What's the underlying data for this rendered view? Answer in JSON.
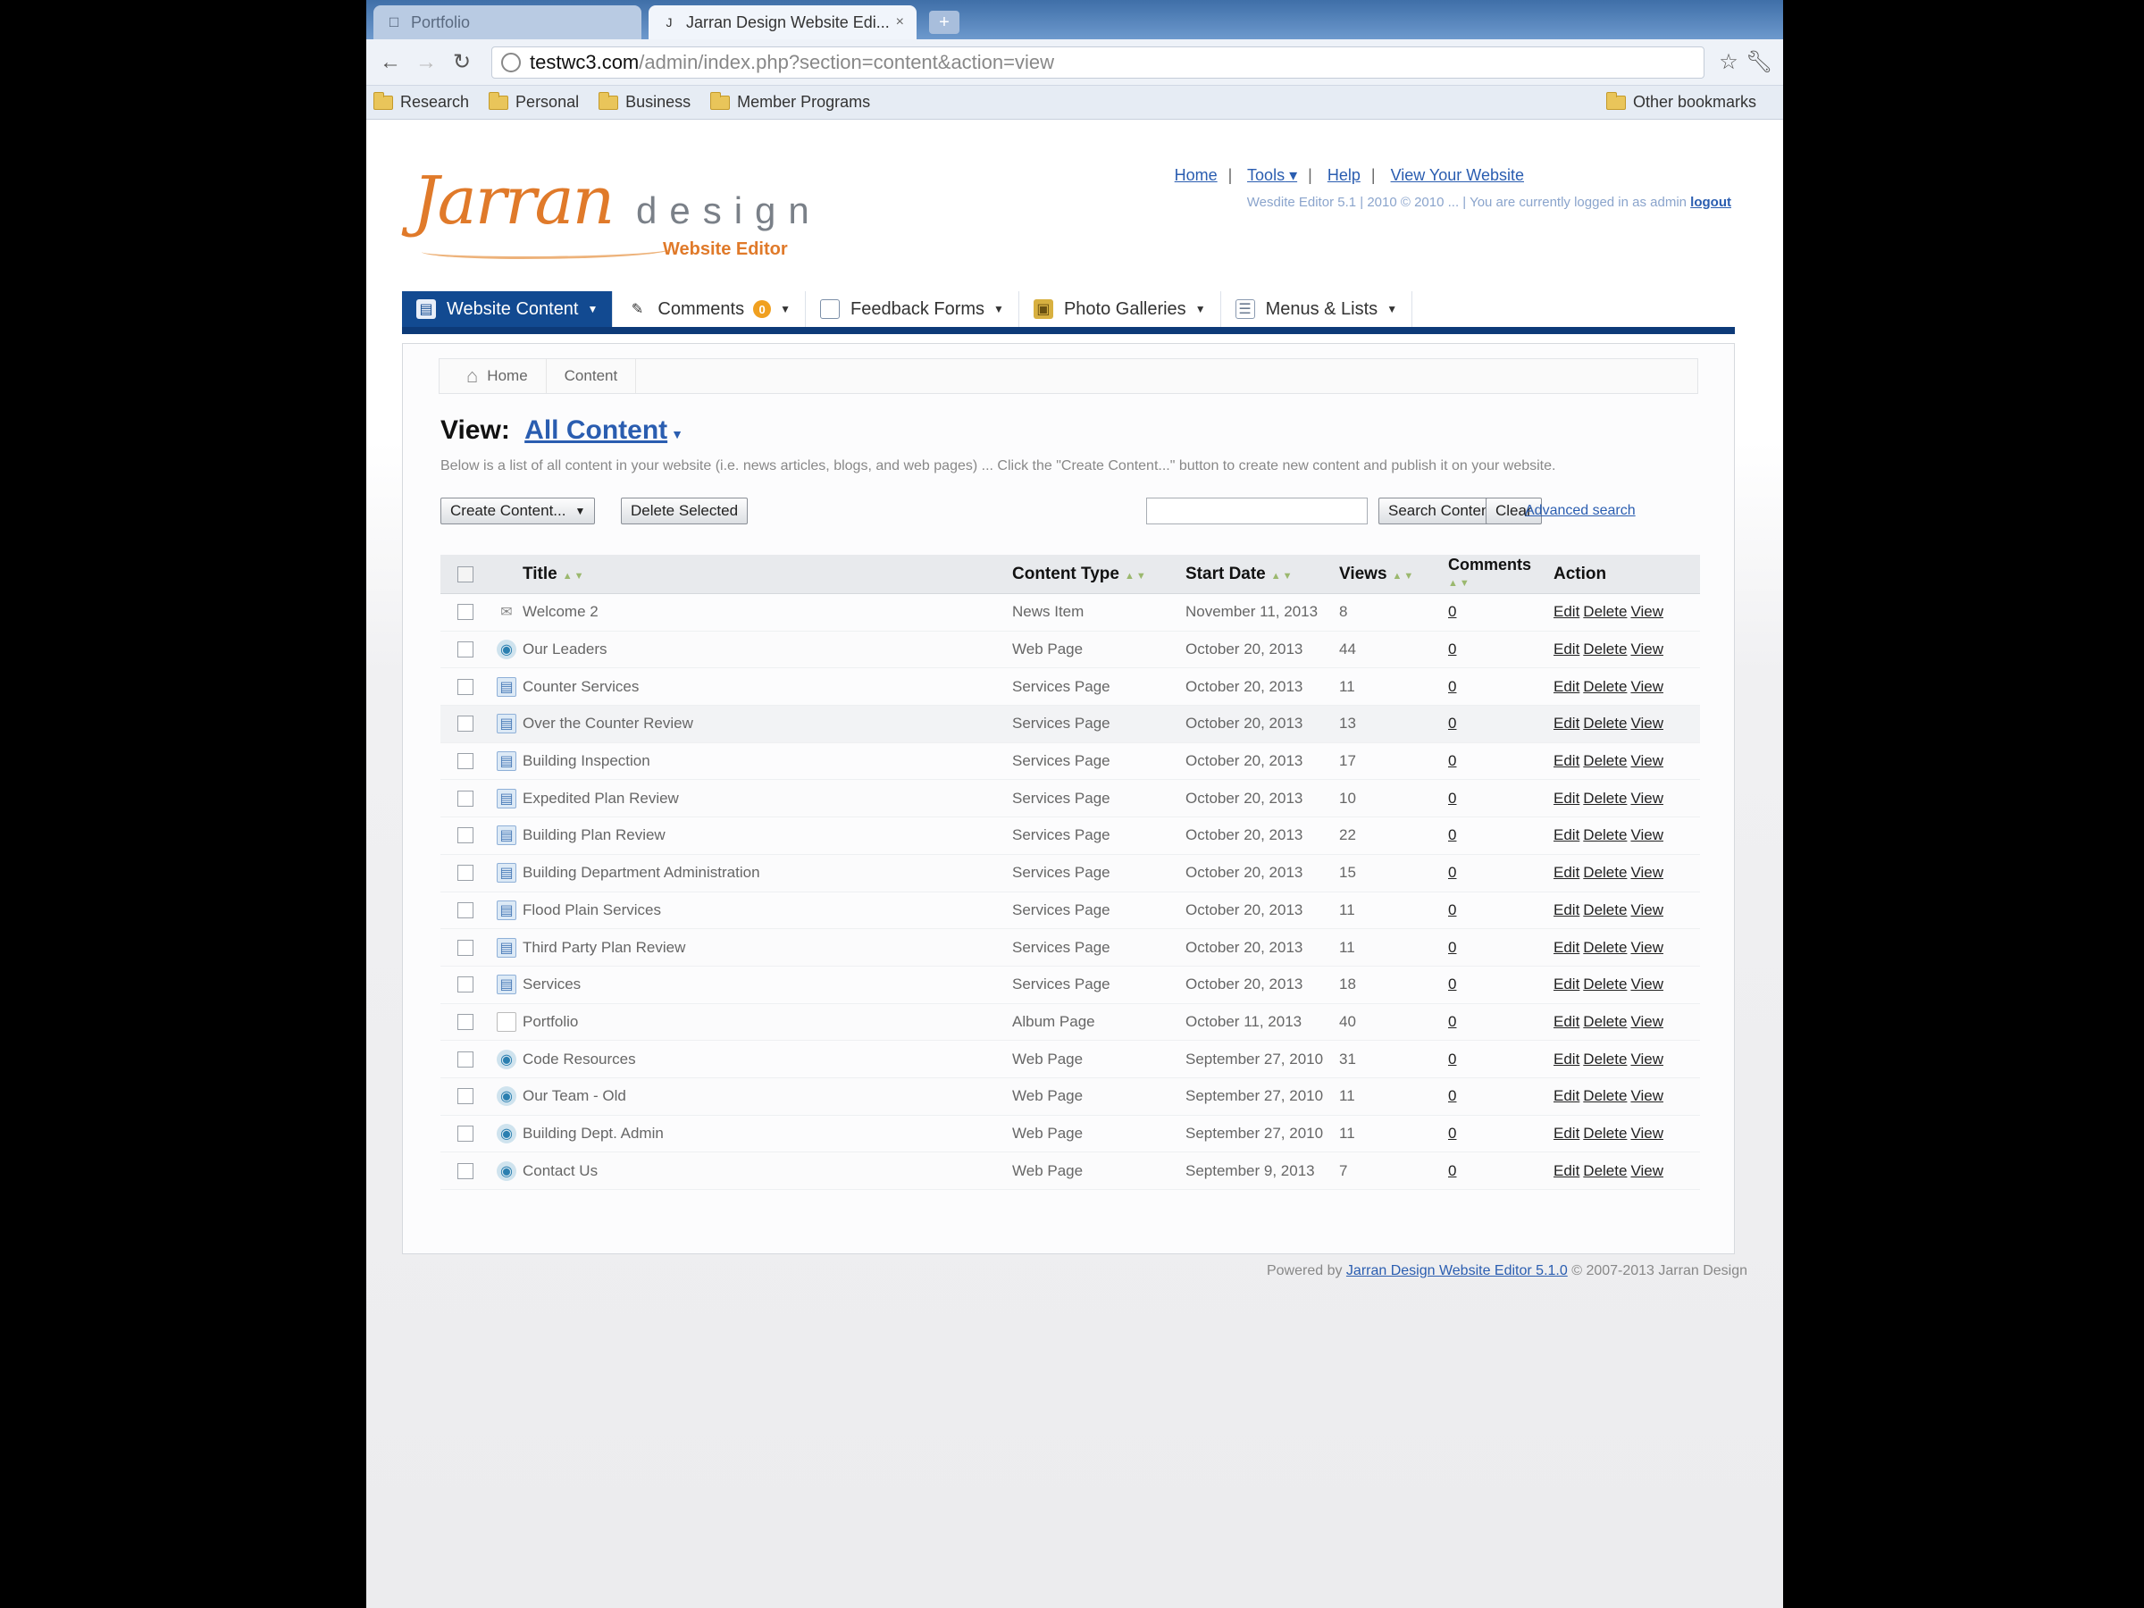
{
  "browser": {
    "tabs": [
      {
        "title": "Portfolio",
        "active": false
      },
      {
        "title": "Jarran Design Website Edi...",
        "active": true
      }
    ],
    "url_host": "testwc3.com",
    "url_path": "/admin/index.php?section=content&action=view",
    "bookmarks": [
      "Research",
      "Personal",
      "Business",
      "Member Programs"
    ],
    "other_bookmarks": "Other bookmarks"
  },
  "header": {
    "logo_jarran": "Jarran",
    "logo_design": "design",
    "logo_sub": "Website Editor",
    "links": [
      "Home",
      "Tools",
      "Help",
      "View Your Website"
    ],
    "status_text": "Wesdite Editor 5.1 | 2010 © 2010 ... | You are currently logged in as admin",
    "logout": "logout"
  },
  "menu": {
    "items": [
      {
        "label": "Website Content",
        "icon": "page-icon",
        "active": true
      },
      {
        "label": "Comments",
        "icon": "pencil-icon",
        "badge": "0"
      },
      {
        "label": "Feedback Forms",
        "icon": "form-icon"
      },
      {
        "label": "Photo Galleries",
        "icon": "photo-icon"
      },
      {
        "label": "Menus & Lists",
        "icon": "list-icon"
      }
    ]
  },
  "breadcrumb": [
    "Home",
    "Content"
  ],
  "view": {
    "label": "View:",
    "selected": "All Content"
  },
  "intro": "Below is a list of all content in your website (i.e. news articles, blogs, and web pages) ... Click the \"Create Content...\" button to create new content and publish it on your website.",
  "toolbar": {
    "create_label": "Create Content...",
    "delete_label": "Delete Selected",
    "search_value": "",
    "search_label": "Search Content",
    "clear_label": "Clear",
    "advanced_label": "Advanced search"
  },
  "table": {
    "headers": {
      "title": "Title",
      "type": "Content Type",
      "date": "Start Date",
      "views": "Views",
      "comments": "Comments",
      "action": "Action"
    },
    "rows": [
      {
        "icon": "news",
        "title": "Welcome 2",
        "type": "News Item",
        "date": "November 11, 2013",
        "views": "8",
        "comments": "0"
      },
      {
        "icon": "web",
        "title": "Our Leaders",
        "type": "Web Page",
        "date": "October 20, 2013",
        "views": "44",
        "comments": "0"
      },
      {
        "icon": "page",
        "title": "Counter Services",
        "type": "Services Page",
        "date": "October 20, 2013",
        "views": "11",
        "comments": "0"
      },
      {
        "icon": "page",
        "title": "Over the Counter Review",
        "type": "Services Page",
        "date": "October 20, 2013",
        "views": "13",
        "comments": "0"
      },
      {
        "icon": "page",
        "title": "Building Inspection",
        "type": "Services Page",
        "date": "October 20, 2013",
        "views": "17",
        "comments": "0"
      },
      {
        "icon": "page",
        "title": "Expedited Plan Review",
        "type": "Services Page",
        "date": "October 20, 2013",
        "views": "10",
        "comments": "0"
      },
      {
        "icon": "page",
        "title": "Building Plan Review",
        "type": "Services Page",
        "date": "October 20, 2013",
        "views": "22",
        "comments": "0"
      },
      {
        "icon": "page",
        "title": "Building Department Administration",
        "type": "Services Page",
        "date": "October 20, 2013",
        "views": "15",
        "comments": "0"
      },
      {
        "icon": "page",
        "title": "Flood Plain Services",
        "type": "Services Page",
        "date": "October 20, 2013",
        "views": "11",
        "comments": "0"
      },
      {
        "icon": "page",
        "title": "Third Party Plan Review",
        "type": "Services Page",
        "date": "October 20, 2013",
        "views": "11",
        "comments": "0"
      },
      {
        "icon": "page",
        "title": "Services",
        "type": "Services Page",
        "date": "October 20, 2013",
        "views": "18",
        "comments": "0"
      },
      {
        "icon": "album",
        "title": "Portfolio",
        "type": "Album Page",
        "date": "October 11, 2013",
        "views": "40",
        "comments": "0"
      },
      {
        "icon": "web",
        "title": "Code Resources",
        "type": "Web Page",
        "date": "September 27, 2010",
        "views": "31",
        "comments": "0"
      },
      {
        "icon": "web",
        "title": "Our Team - Old",
        "type": "Web Page",
        "date": "September 27, 2010",
        "views": "11",
        "comments": "0"
      },
      {
        "icon": "web",
        "title": "Building Dept. Admin",
        "type": "Web Page",
        "date": "September 27, 2010",
        "views": "11",
        "comments": "0"
      },
      {
        "icon": "web",
        "title": "Contact Us",
        "type": "Web Page",
        "date": "September 9, 2013",
        "views": "7",
        "comments": "0"
      }
    ],
    "actions": [
      "Edit",
      "Delete",
      "View"
    ]
  },
  "footer": {
    "prefix": "Powered by",
    "link": "Jarran Design Website Editor 5.1.0",
    "suffix": "© 2007-2013 Jarran Design"
  },
  "colors": {
    "menu_active": "#124a91",
    "menu_bar": "#0d3a78",
    "logo_orange": "#e07a2a",
    "link_blue": "#2a5db0"
  }
}
